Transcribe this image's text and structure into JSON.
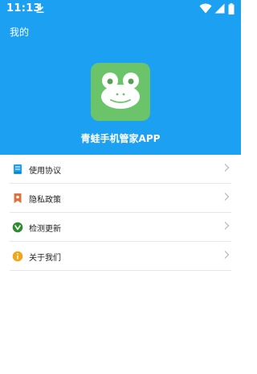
{
  "status_bar": {
    "time": "11:13",
    "icons": [
      "download-icon",
      "wifi-icon",
      "signal-icon",
      "battery-icon"
    ]
  },
  "header": {
    "title": "我的",
    "app_name": "青蛙手机管家APP",
    "logo": "frog-logo",
    "background_color": "#1ba0f2"
  },
  "menu": {
    "items": [
      {
        "label": "使用协议",
        "icon": "document-icon",
        "icon_color": "#1ba0f2"
      },
      {
        "label": "隐私政策",
        "icon": "bookmark-icon",
        "icon_color": "#e0703a"
      },
      {
        "label": "检测更新",
        "icon": "check-circle-icon",
        "icon_color": "#2e8b2e"
      },
      {
        "label": "关于我们",
        "icon": "info-icon",
        "icon_color": "#f0a81a"
      }
    ]
  }
}
